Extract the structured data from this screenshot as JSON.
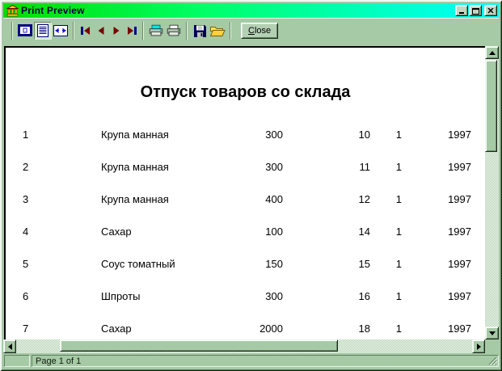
{
  "window": {
    "title": "Print Preview"
  },
  "colors": {
    "titlebar_gradient_start": "#00dd00",
    "titlebar_gradient_end": "#00ffff",
    "title_text": "#000038",
    "window_face": "#a6c9a6",
    "nav_arrow": "#7b0000",
    "nav_bar": "#000080",
    "page_background": "#ffffff"
  },
  "icons": {
    "app": "bank-building",
    "minimize": "underscore-bar",
    "maximize": "square-frame",
    "close_window": "x-cross",
    "zoom_fit": "page-in-frame",
    "zoom_100": "page-with-lines",
    "zoom_width": "page-with-horizontal-arrows",
    "first_page": "bar-left-triangle",
    "prior_page": "left-triangle",
    "next_page": "right-triangle",
    "last_page": "right-triangle-bar",
    "printer_setup": "printer-cyan-sheet",
    "print": "printer-white-sheet",
    "save": "floppy-disk",
    "open": "open-folder",
    "scroll_up": "triangle-up",
    "scroll_down": "triangle-down",
    "scroll_left": "triangle-left",
    "scroll_right": "triangle-right"
  },
  "toolbar": {
    "close_accel": "C",
    "close_rest": "lose"
  },
  "report": {
    "title": "Отпуск товаров со склада",
    "rows": [
      {
        "num": "1",
        "name": "Крупа манная",
        "qty": "300",
        "day": "10",
        "month": "1",
        "year": "1997"
      },
      {
        "num": "2",
        "name": "Крупа манная",
        "qty": "300",
        "day": "11",
        "month": "1",
        "year": "1997"
      },
      {
        "num": "3",
        "name": "Крупа манная",
        "qty": "400",
        "day": "12",
        "month": "1",
        "year": "1997"
      },
      {
        "num": "4",
        "name": "Сахар",
        "qty": "100",
        "day": "14",
        "month": "1",
        "year": "1997"
      },
      {
        "num": "5",
        "name": "Соус томатный",
        "qty": "150",
        "day": "15",
        "month": "1",
        "year": "1997"
      },
      {
        "num": "6",
        "name": "Шпроты",
        "qty": "300",
        "day": "16",
        "month": "1",
        "year": "1997"
      },
      {
        "num": "7",
        "name": "Сахар",
        "qty": "2000",
        "day": "18",
        "month": "1",
        "year": "1997"
      }
    ]
  },
  "statusbar": {
    "page_info": "Page 1 of 1"
  }
}
